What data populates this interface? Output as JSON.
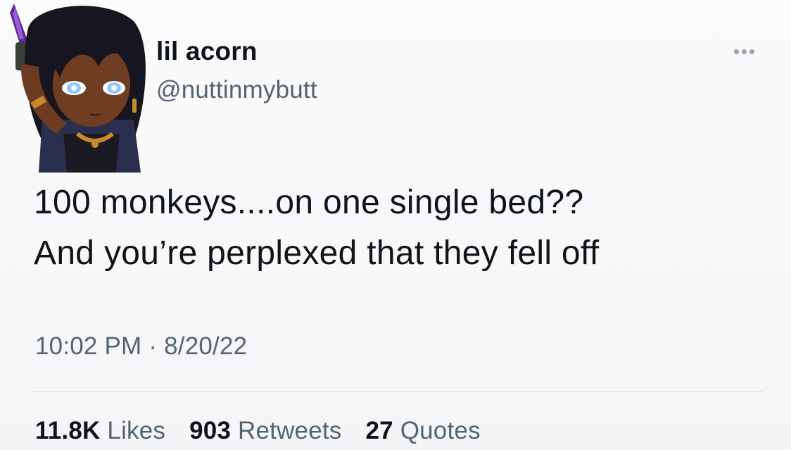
{
  "tweet": {
    "display_name": "lil acorn",
    "handle": "@nuttinmybutt",
    "text_lines": [
      "100 monkeys....on one single bed??",
      "And you’re perplexed that they fell off"
    ],
    "timestamp": "10:02 PM · 8/20/22",
    "stats": {
      "likes_count": "11.8K",
      "likes_label": "Likes",
      "retweets_count": "903",
      "retweets_label": "Retweets",
      "quotes_count": "27",
      "quotes_label": "Quotes"
    },
    "more_icon": "more-horizontal-icon"
  },
  "colors": {
    "text_primary": "#0f1419",
    "text_secondary": "#536471",
    "divider": "#d9dde1"
  }
}
